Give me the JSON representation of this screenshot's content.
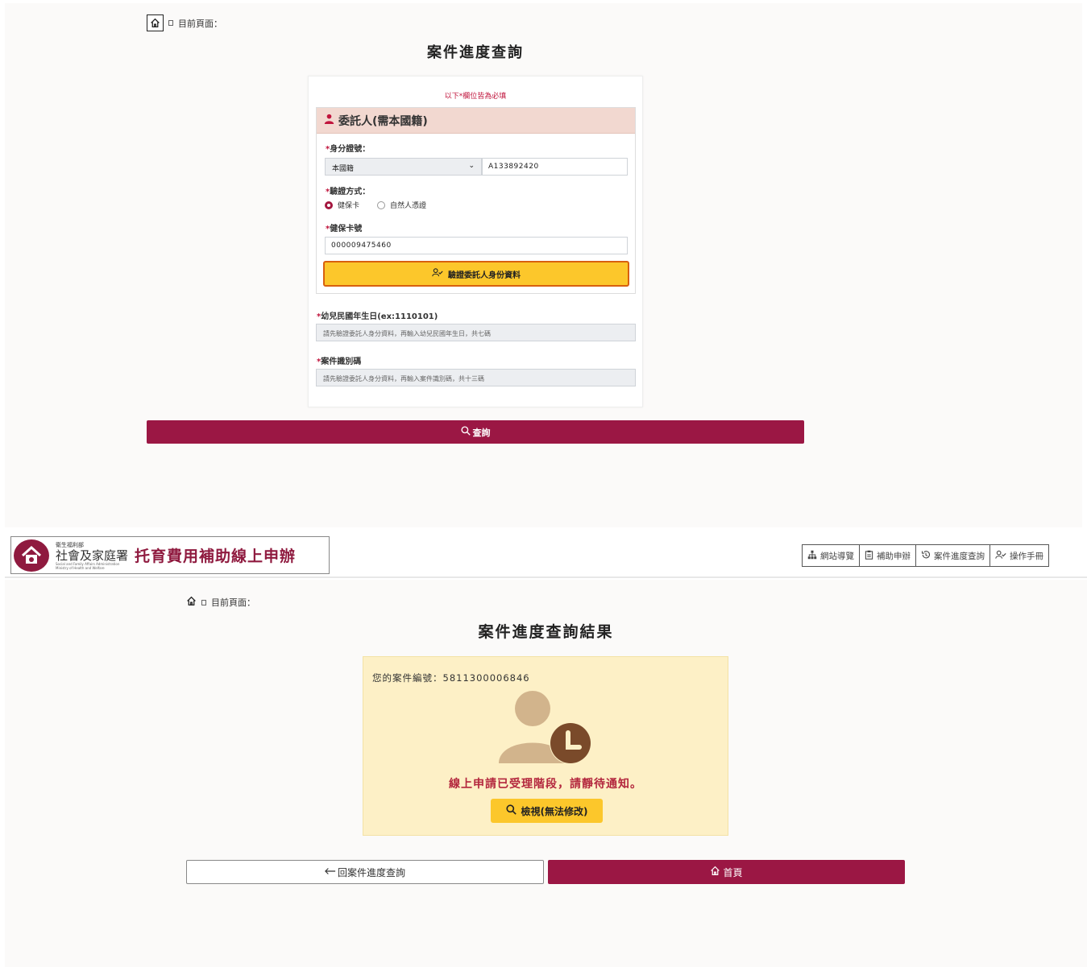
{
  "query_page": {
    "breadcrumb_label": "目前頁面：",
    "title": "案件進度查詢",
    "required_note": "以下*欄位皆為必填",
    "client_section": {
      "heading": "委託人(需本國籍)",
      "id_label": "身分證號：",
      "nationality_select": "本國籍",
      "id_value": "A133892420",
      "verify_method_label": "驗證方式：",
      "radio_options": [
        "健保卡",
        "自然人憑證"
      ],
      "selected_radio": "健保卡",
      "card_label": "健保卡號",
      "card_value": "000009475460",
      "verify_button": "驗證委託人身份資料"
    },
    "birthday_label": "幼兒民國年生日(ex:1110101)",
    "birthday_placeholder": "請先驗證委託人身分資料，再輸入幼兒民國年生日，共七碼",
    "case_code_label": "案件識別碼",
    "case_code_placeholder": "請先驗證委託人身分資料，再輸入案件識別碼，共十三碼",
    "query_button": "查詢",
    "required_mark": "*"
  },
  "header": {
    "logo_small": "衛生福利部",
    "logo_org": "社會及家庭署",
    "logo_en_1": "Social and Family Affairs Administration",
    "logo_en_2": "Ministry of Health and Welfare",
    "app_title": "托育費用補助線上申辦",
    "nav": [
      {
        "label": "網站導覽",
        "icon": "sitemap-icon"
      },
      {
        "label": "補助申辦",
        "icon": "clipboard-icon"
      },
      {
        "label": "案件進度查詢",
        "icon": "history-icon"
      },
      {
        "label": "操作手冊",
        "icon": "user-check-icon"
      }
    ]
  },
  "result_page": {
    "breadcrumb_label": "目前頁面：",
    "title": "案件進度查詢結果",
    "case_number_label": "您的案件編號：",
    "case_number": "5811300006846",
    "status_message": "線上申請已受理階段，請靜待通知。",
    "view_button": "檢視(無法修改)",
    "back_button": "回案件進度查詢",
    "home_button": "首頁"
  },
  "colors": {
    "brand": "#9b1744",
    "accent_yellow": "#fcc72b",
    "required_red": "#c0143c",
    "result_bg": "#fdf0c6",
    "status_text": "#b3263d"
  }
}
